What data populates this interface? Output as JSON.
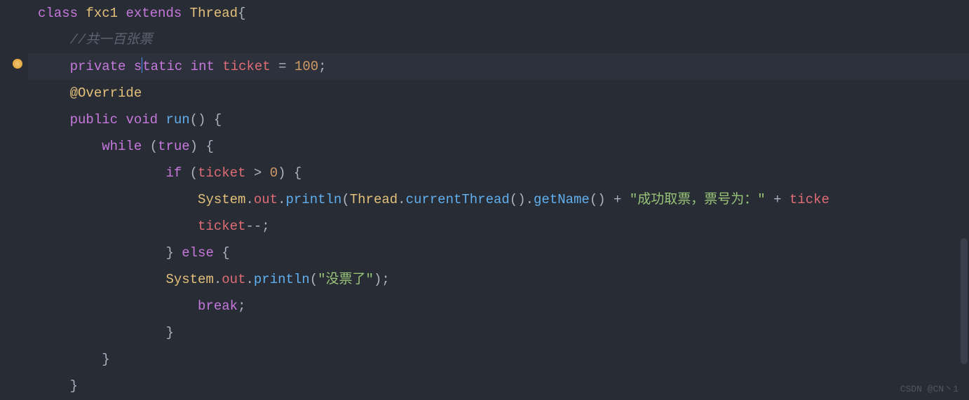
{
  "code": {
    "line1": {
      "kw_class": "class",
      "classname": "fxc1",
      "kw_extends": "extends",
      "parent": "Thread",
      "brace": "{"
    },
    "line2": {
      "indent": "    ",
      "comment": "//共一百张票"
    },
    "line3": {
      "indent": "    ",
      "kw_private": "private",
      "kw_s": "s",
      "kw_tatic": "tatic",
      "kw_int": "int",
      "field": "ticket",
      "eq": " = ",
      "num": "100",
      "semi": ";"
    },
    "line4": {
      "indent": "    ",
      "annotation": "@Override"
    },
    "line5": {
      "indent": "    ",
      "kw_public": "public",
      "kw_void": "void",
      "method": "run",
      "parens": "()",
      "brace": " {"
    },
    "line6": {
      "indent": "        ",
      "kw_while": "while",
      "space": " ",
      "lparen": "(",
      "kw_true": "true",
      "rparen": ")",
      "brace": " {"
    },
    "line7": {
      "indent": "                ",
      "kw_if": "if",
      "space": " ",
      "lparen": "(",
      "field": "ticket",
      "op": " > ",
      "num": "0",
      "rparen": ")",
      "brace": " {"
    },
    "line8": {
      "indent": "                    ",
      "sys": "System",
      "dot1": ".",
      "out": "out",
      "dot2": ".",
      "println": "println",
      "lparen": "(",
      "thread": "Thread",
      "dot3": ".",
      "ct": "currentThread",
      "parens1": "()",
      "dot4": ".",
      "gn": "getName",
      "parens2": "()",
      "plus1": " + ",
      "str": "\"成功取票，票号为：\"",
      "plus2": " + ",
      "ticket": "ticke"
    },
    "line9": {
      "indent": "                    ",
      "field": "ticket",
      "op": "--",
      "semi": ";"
    },
    "line10": {
      "indent": "                ",
      "rbrace": "}",
      "space": " ",
      "kw_else": "else",
      "brace": " {"
    },
    "line11": {
      "indent": "                ",
      "sys": "System",
      "dot1": ".",
      "out": "out",
      "dot2": ".",
      "println": "println",
      "lparen": "(",
      "str": "\"没票了\"",
      "rparen": ")",
      "semi": ";"
    },
    "line12": {
      "indent": "                    ",
      "kw_break": "break",
      "semi": ";"
    },
    "line13": {
      "indent": "                ",
      "rbrace": "}"
    },
    "line14": {
      "indent": "        ",
      "rbrace": "}"
    },
    "line15": {
      "indent": "    ",
      "rbrace": "}"
    }
  },
  "watermark": "CSDN @CN丶1"
}
